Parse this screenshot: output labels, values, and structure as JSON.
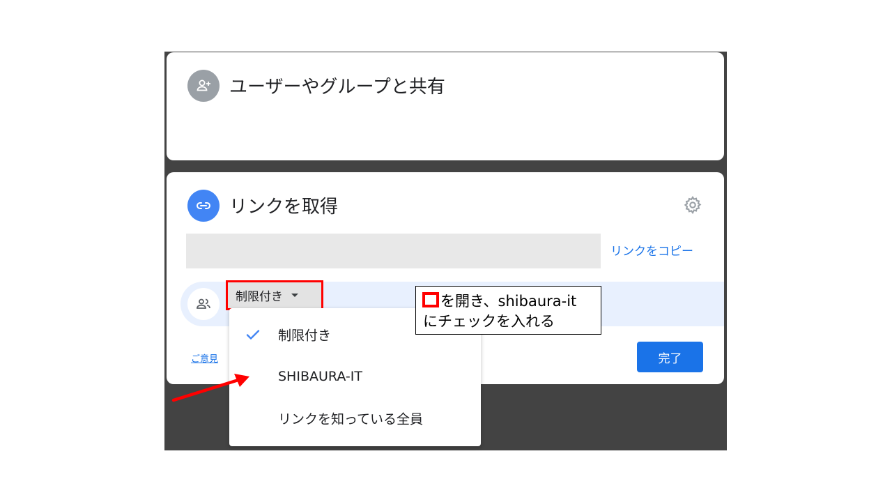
{
  "share_card": {
    "title": "ユーザーやグループと共有",
    "icon": "person-add-icon"
  },
  "link_card": {
    "title": "リンクを取得",
    "icon": "link-icon",
    "settings_icon": "gear-icon",
    "copy_link_label": "リンクをコピー",
    "access_icon": "people-icon",
    "feedback_label": "ご意見",
    "done_label": "完了"
  },
  "dropdown": {
    "selected_label": "制限付き",
    "items": [
      {
        "label": "制限付き",
        "checked": true
      },
      {
        "label": "SHIBAURA-IT",
        "checked": false
      },
      {
        "label": "リンクを知っている全員",
        "checked": false
      }
    ]
  },
  "annotation": {
    "line1": "を開き、shibaura-it",
    "line2": "にチェックを入れる"
  },
  "colors": {
    "backdrop": "#434343",
    "accent_blue": "#1a73e8",
    "link_icon_blue": "#4285f4",
    "highlight_red": "#ff0000",
    "access_row_bg": "#e8f0fe"
  }
}
